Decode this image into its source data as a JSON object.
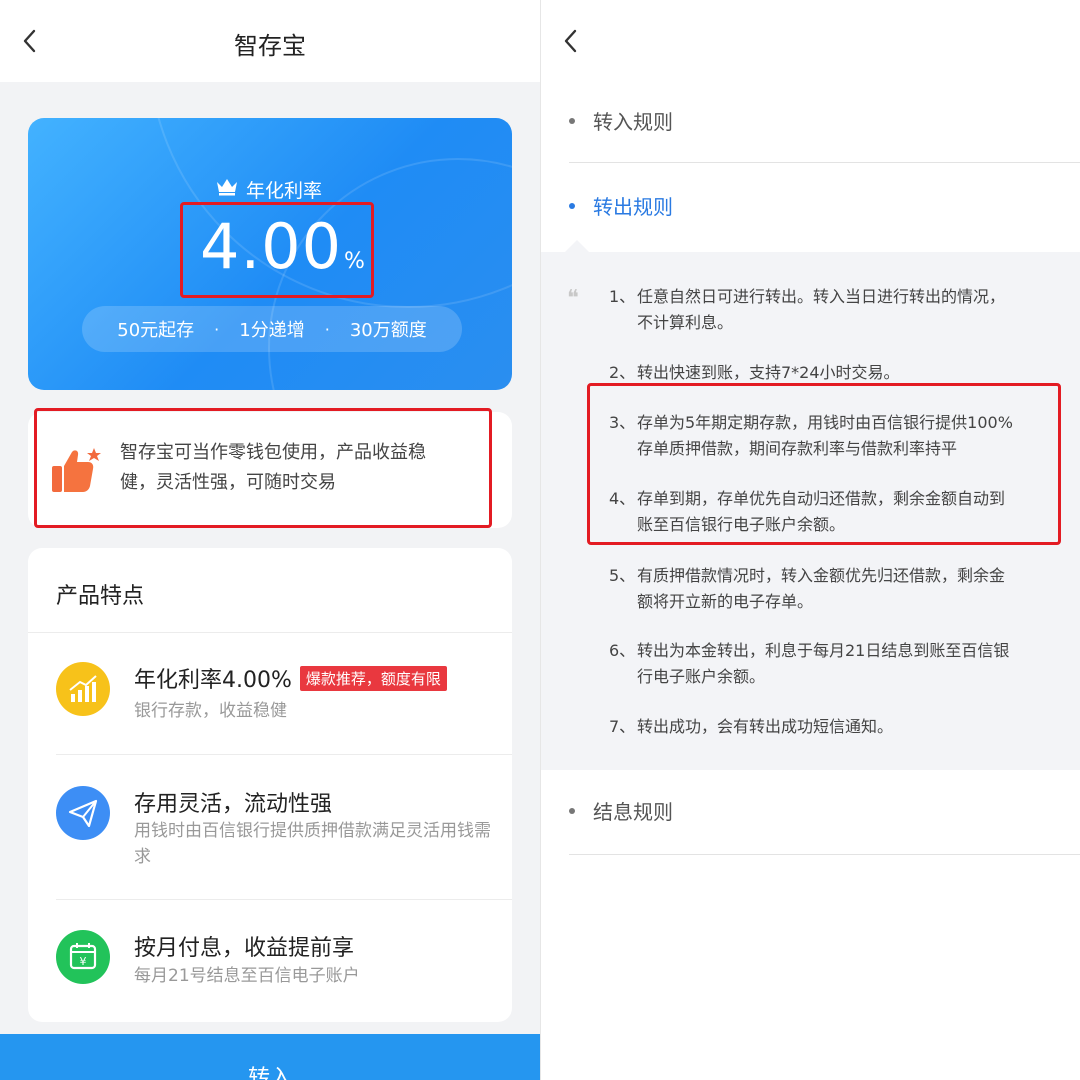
{
  "left": {
    "title": "智存宝",
    "rate_label": "年化利率",
    "rate_value": "4.00",
    "rate_unit": "%",
    "tags": [
      "50元起存",
      "1分递增",
      "30万额度"
    ],
    "tag_separator": "·",
    "tip_line1": "智存宝可当作零钱包使用，产品收益稳",
    "tip_line2": "健，灵活性强，可随时交易",
    "features_title": "产品特点",
    "features": [
      {
        "icon": "chart-growth-icon",
        "title": "年化利率4.00%",
        "badge": "爆款推荐，额度有限",
        "desc": "银行存款，收益稳健"
      },
      {
        "icon": "paper-plane-icon",
        "title": "存用灵活，流动性强",
        "desc": "用钱时由百信银行提供质押借款满足灵活用钱需求"
      },
      {
        "icon": "calendar-yen-icon",
        "title": "按月付息，收益提前享",
        "desc": "每月21号结息至百信电子账户"
      }
    ],
    "action_label": "转入"
  },
  "right": {
    "sections": [
      "转入规则",
      "转出规则",
      "结息规则"
    ],
    "rules": [
      {
        "num": "1、",
        "lines": [
          "任意自然日可进行转出。转入当日进行转出的情况，",
          "不计算利息。"
        ]
      },
      {
        "num": "2、",
        "lines": [
          "转出快速到账，支持7*24小时交易。"
        ]
      },
      {
        "num": "3、",
        "lines": [
          "存单为5年期定期存款，用钱时由百信银行提供100%",
          "存单质押借款，期间存款利率与借款利率持平"
        ]
      },
      {
        "num": "4、",
        "lines": [
          "存单到期，存单优先自动归还借款，剩余金额自动到",
          "账至百信银行电子账户余额。"
        ]
      },
      {
        "num": "5、",
        "lines": [
          "有质押借款情况时，转入金额优先归还借款，剩余金",
          "额将开立新的电子存单。"
        ]
      },
      {
        "num": "6、",
        "lines": [
          "转出为本金转出，利息于每月21日结息到账至百信银",
          "行电子账户余额。"
        ]
      },
      {
        "num": "7、",
        "lines": [
          "转出成功，会有转出成功短信通知。"
        ]
      }
    ]
  },
  "colors": {
    "accent": "#2596f0",
    "active_section": "#2a7ae2",
    "highlight_border": "#e31b23",
    "hot_badge": "#e9383f"
  }
}
